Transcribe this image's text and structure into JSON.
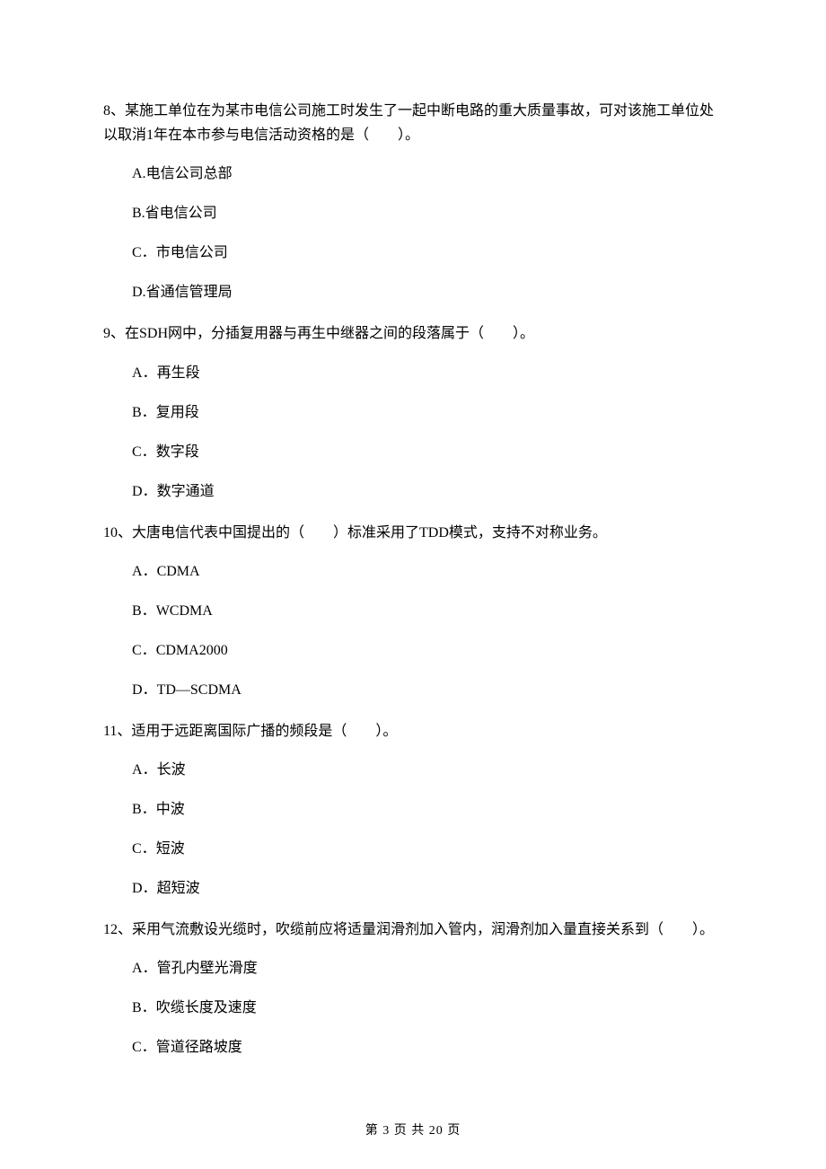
{
  "questions": [
    {
      "number": "8、",
      "text": "某施工单位在为某市电信公司施工时发生了一起中断电路的重大质量事故，可对该施工单位处以取消1年在本市参与电信活动资格的是（　　）。",
      "options": [
        {
          "label": "A.",
          "text": "电信公司总部"
        },
        {
          "label": "B.",
          "text": "省电信公司"
        },
        {
          "label": "C．",
          "text": "市电信公司"
        },
        {
          "label": "D.",
          "text": "省通信管理局"
        }
      ]
    },
    {
      "number": "9、",
      "text": "在SDH网中，分插复用器与再生中继器之间的段落属于（　　）。",
      "options": [
        {
          "label": "A．",
          "text": "再生段"
        },
        {
          "label": "B．",
          "text": "复用段"
        },
        {
          "label": "C．",
          "text": "数字段"
        },
        {
          "label": "D．",
          "text": "数字通道"
        }
      ]
    },
    {
      "number": "10、",
      "text": "大唐电信代表中国提出的（　　）标准采用了TDD模式，支持不对称业务。",
      "options": [
        {
          "label": "A．",
          "text": "CDMA"
        },
        {
          "label": "B．",
          "text": "WCDMA"
        },
        {
          "label": "C．",
          "text": "CDMA2000"
        },
        {
          "label": "D．",
          "text": "TD—SCDMA"
        }
      ]
    },
    {
      "number": "11、",
      "text": "适用于远距离国际广播的频段是（　　）。",
      "options": [
        {
          "label": "A．",
          "text": "长波"
        },
        {
          "label": "B．",
          "text": "中波"
        },
        {
          "label": "C．",
          "text": "短波"
        },
        {
          "label": "D．",
          "text": "超短波"
        }
      ]
    },
    {
      "number": "12、",
      "text": "采用气流敷设光缆时，吹缆前应将适量润滑剂加入管内，润滑剂加入量直接关系到（　　）。",
      "options": [
        {
          "label": "A．",
          "text": "管孔内壁光滑度"
        },
        {
          "label": "B．",
          "text": "吹缆长度及速度"
        },
        {
          "label": "C．",
          "text": "管道径路坡度"
        }
      ]
    }
  ],
  "footer": "第 3 页 共 20 页"
}
